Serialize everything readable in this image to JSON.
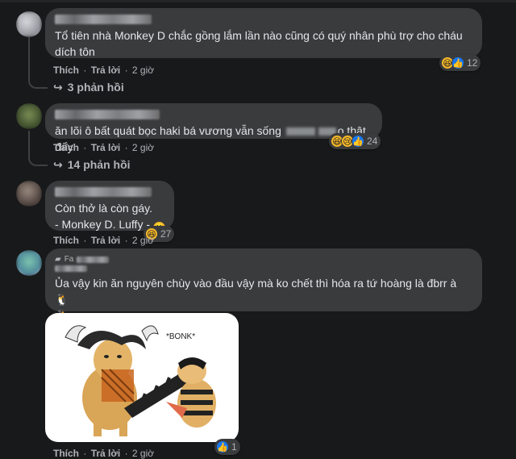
{
  "actions": {
    "like": "Thích",
    "reply": "Trả lời",
    "dot": "·"
  },
  "comments": [
    {
      "text": "Tổ tiên nhà Monkey D chắc gồng lắm lần nào cũng có quý nhân phù trợ cho cháu\ndích tôn",
      "time": "2 giờ",
      "reaction_count": "12",
      "reactions": [
        "haha-icon",
        "like-icon"
      ],
      "replies": "3 phản hồi"
    },
    {
      "text_before": "ăn lõi ô bất quát bọc haki bá vương vẫn sống",
      "text_after": "o thật đấy",
      "time": "2 giờ",
      "reaction_count": "24",
      "reactions": [
        "haha-icon",
        "sad-icon",
        "like-icon"
      ],
      "replies": "14 phản hồi"
    },
    {
      "line1": "Còn thở là còn gáy.",
      "line2": "- Monkey D. Luffy -",
      "time": "2 giờ",
      "reaction_count": "27",
      "reactions": [
        "haha-icon"
      ]
    },
    {
      "badge": "Fa",
      "text": "Ủa vậy kin ăn nguyên chùy vào đầu vậy mà ko chết thì hóa ra tứ hoàng là đbrr à",
      "image_caption": "*BONK*",
      "time": "2 giờ",
      "reaction_count": "1",
      "reactions": [
        "like-icon"
      ]
    }
  ],
  "colors": {
    "background": "#18191a",
    "bubble": "#3a3b3c",
    "text": "#e4e6eb",
    "secondary": "#b0b3b8",
    "like": "#1877f2",
    "haha": "#f7b928"
  }
}
